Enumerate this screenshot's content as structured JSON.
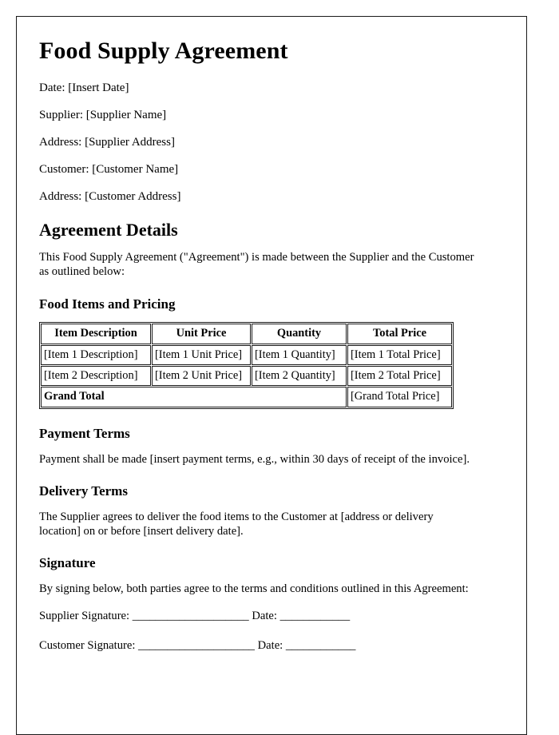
{
  "document": {
    "title": "Food Supply Agreement",
    "meta_lines": [
      "Date: [Insert Date]",
      "Supplier: [Supplier Name]",
      "Address: [Supplier Address]",
      "Customer: [Customer Name]",
      "Address: [Customer Address]"
    ],
    "sections": {
      "agreement_details": {
        "heading": "Agreement Details",
        "intro": "This Food Supply Agreement (\"Agreement\") is made between the Supplier and the Customer as outlined below:"
      },
      "food_items": {
        "heading": "Food Items and Pricing",
        "table": {
          "headers": [
            "Item Description",
            "Unit Price",
            "Quantity",
            "Total Price"
          ],
          "rows": [
            [
              "[Item 1 Description]",
              "[Item 1 Unit Price]",
              "[Item 1 Quantity]",
              "[Item 1 Total Price]"
            ],
            [
              "[Item 2 Description]",
              "[Item 2 Unit Price]",
              "[Item 2 Quantity]",
              "[Item 2 Total Price]"
            ]
          ],
          "total_row": {
            "label": "Grand Total",
            "value": "[Grand Total Price]"
          }
        }
      },
      "payment_terms": {
        "heading": "Payment Terms",
        "body": "Payment shall be made [insert payment terms, e.g., within 30 days of receipt of the invoice]."
      },
      "delivery_terms": {
        "heading": "Delivery Terms",
        "body": "The Supplier agrees to deliver the food items to the Customer at [address or delivery location] on or before [insert delivery date]."
      },
      "signature": {
        "heading": "Signature",
        "body": "By signing below, both parties agree to the terms and conditions outlined in this Agreement:",
        "supplier_line": "Supplier Signature: ____________________ Date: ____________",
        "customer_line": "Customer Signature: ____________________ Date: ____________"
      }
    }
  }
}
